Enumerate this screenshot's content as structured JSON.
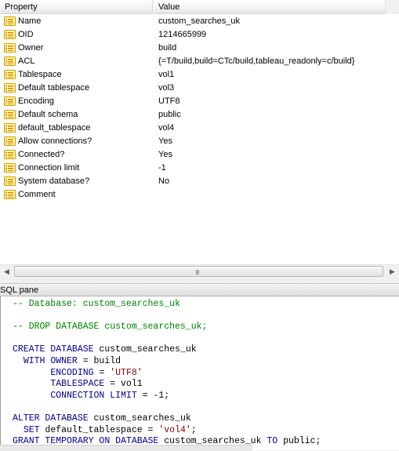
{
  "columns": {
    "property": "Property",
    "value": "Value"
  },
  "properties": [
    {
      "name": "Name",
      "value": "custom_searches_uk"
    },
    {
      "name": "OID",
      "value": "1214665999"
    },
    {
      "name": "Owner",
      "value": "build"
    },
    {
      "name": "ACL",
      "value": "{=T/build,build=CTc/build,tableau_readonly=c/build}"
    },
    {
      "name": "Tablespace",
      "value": "vol1"
    },
    {
      "name": "Default tablespace",
      "value": "vol3"
    },
    {
      "name": "Encoding",
      "value": "UTF8"
    },
    {
      "name": "Default schema",
      "value": "public"
    },
    {
      "name": "default_tablespace",
      "value": "vol4"
    },
    {
      "name": "Allow connections?",
      "value": "Yes"
    },
    {
      "name": "Connected?",
      "value": "Yes"
    },
    {
      "name": "Connection limit",
      "value": "-1"
    },
    {
      "name": "System database?",
      "value": "No"
    },
    {
      "name": "Comment",
      "value": ""
    }
  ],
  "scrollbar": {
    "grip": "III"
  },
  "sql_pane": {
    "title": "SQL pane",
    "lines": [
      {
        "k": "cm",
        "t": "-- Database: custom_searches_uk"
      },
      {
        "k": "pl",
        "t": ""
      },
      {
        "k": "cm",
        "t": "-- DROP DATABASE custom_searches_uk;"
      },
      {
        "k": "pl",
        "t": ""
      },
      {
        "parts": [
          {
            "k": "kw",
            "t": "CREATE DATABASE"
          },
          {
            "k": "pl",
            "t": " custom_searches_uk"
          }
        ]
      },
      {
        "parts": [
          {
            "k": "pl",
            "t": "  "
          },
          {
            "k": "kw",
            "t": "WITH OWNER"
          },
          {
            "k": "pl",
            "t": " = build"
          }
        ]
      },
      {
        "parts": [
          {
            "k": "pl",
            "t": "       "
          },
          {
            "k": "kw",
            "t": "ENCODING"
          },
          {
            "k": "pl",
            "t": " = "
          },
          {
            "k": "str",
            "t": "'UTF8'"
          }
        ]
      },
      {
        "parts": [
          {
            "k": "pl",
            "t": "       "
          },
          {
            "k": "kw",
            "t": "TABLESPACE"
          },
          {
            "k": "pl",
            "t": " = vol1"
          }
        ]
      },
      {
        "parts": [
          {
            "k": "pl",
            "t": "       "
          },
          {
            "k": "kw",
            "t": "CONNECTION LIMIT"
          },
          {
            "k": "pl",
            "t": " = -1;"
          }
        ]
      },
      {
        "k": "pl",
        "t": ""
      },
      {
        "parts": [
          {
            "k": "kw",
            "t": "ALTER DATABASE"
          },
          {
            "k": "pl",
            "t": " custom_searches_uk"
          }
        ]
      },
      {
        "parts": [
          {
            "k": "pl",
            "t": "  "
          },
          {
            "k": "kw",
            "t": "SET"
          },
          {
            "k": "pl",
            "t": " default_tablespace = "
          },
          {
            "k": "str",
            "t": "'vol4'"
          },
          {
            "k": "pl",
            "t": ";"
          }
        ]
      },
      {
        "parts": [
          {
            "k": "kw",
            "t": "GRANT TEMPORARY ON DATABASE"
          },
          {
            "k": "pl",
            "t": " custom_searches_uk "
          },
          {
            "k": "kw",
            "t": "TO"
          },
          {
            "k": "pl",
            "t": " public;"
          }
        ]
      }
    ]
  },
  "icon": "property-icon"
}
